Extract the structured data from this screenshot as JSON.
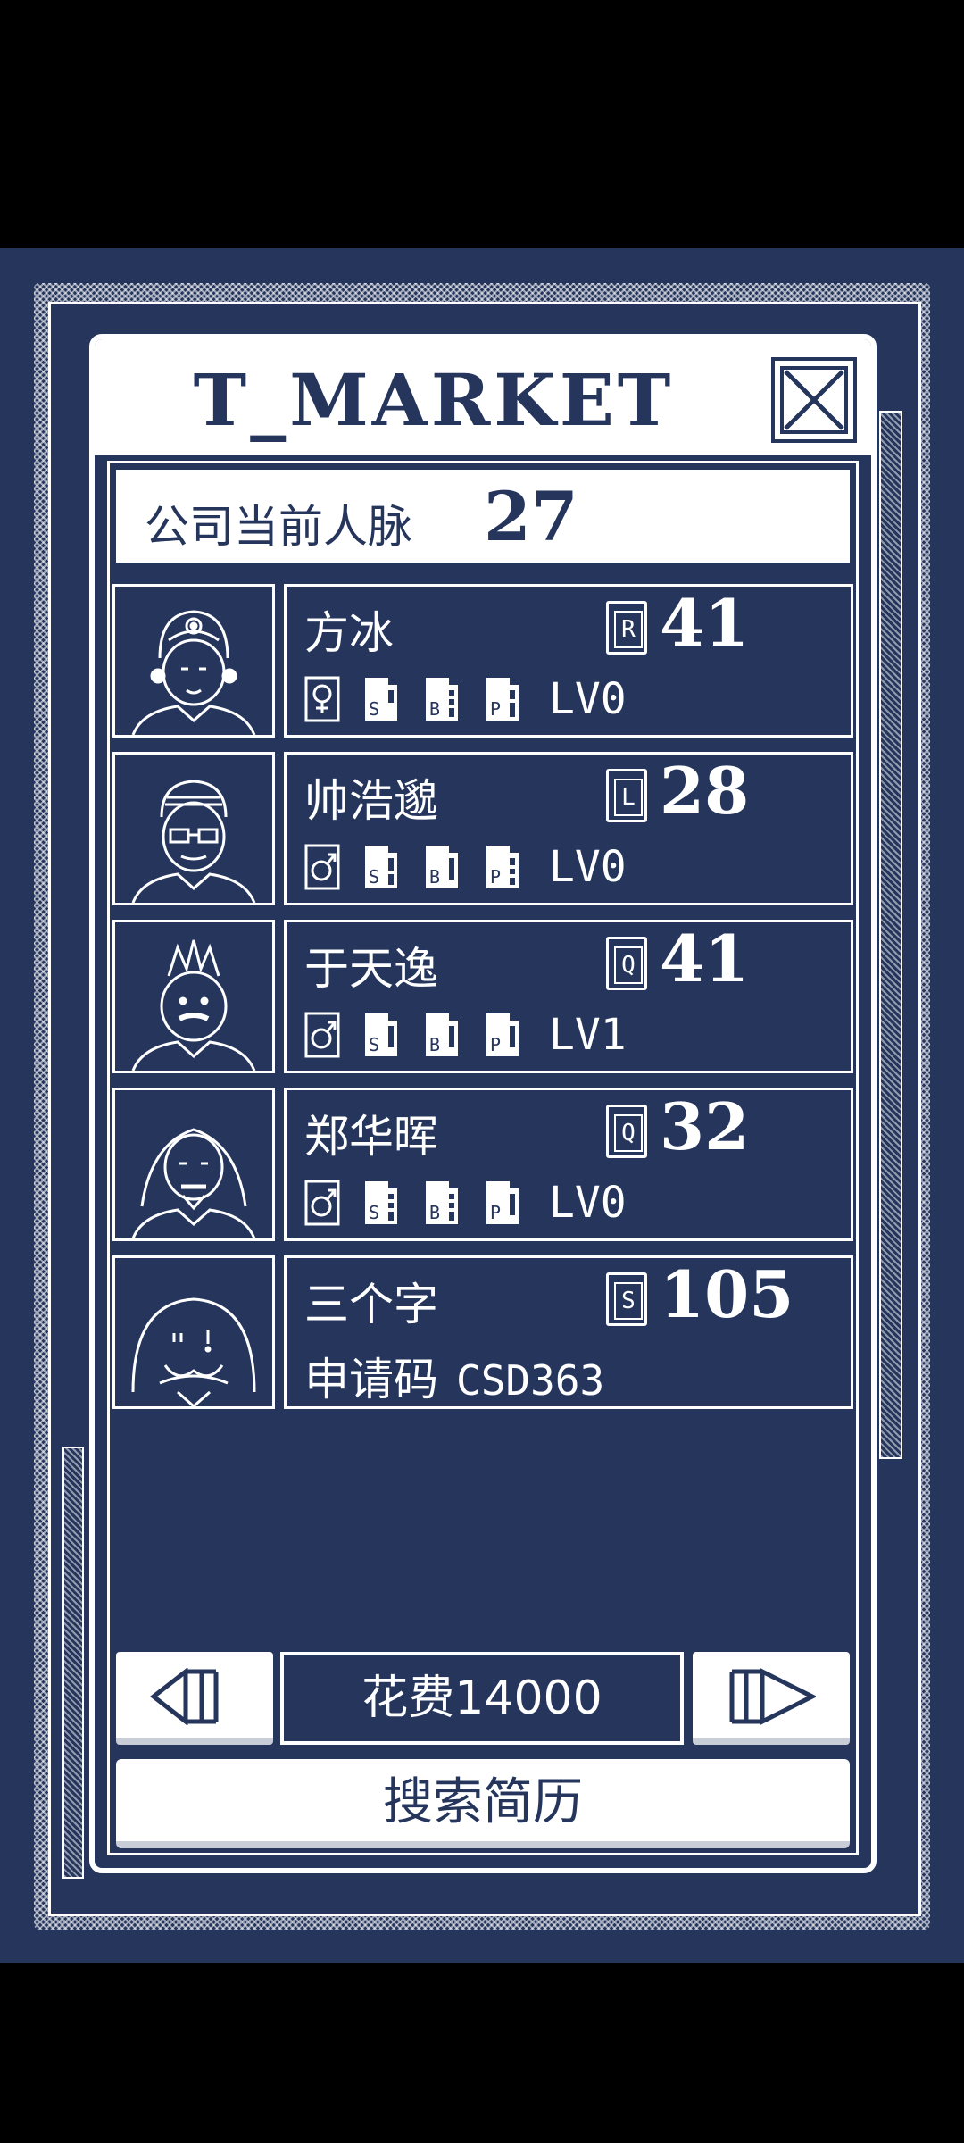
{
  "title": "T_MARKET",
  "network": {
    "label": "公司当前人脉",
    "value": "27"
  },
  "candidates": [
    {
      "name": "方冰",
      "rank": "R",
      "score": "41",
      "gender": "female",
      "stats": [
        "S",
        "B",
        "P"
      ],
      "level": "LV0"
    },
    {
      "name": "帅浩邈",
      "rank": "L",
      "score": "28",
      "gender": "male",
      "stats": [
        "S",
        "B",
        "P"
      ],
      "level": "LV0"
    },
    {
      "name": "于天逸",
      "rank": "Q",
      "score": "41",
      "gender": "male",
      "stats": [
        "S",
        "B",
        "P"
      ],
      "level": "LV1"
    },
    {
      "name": "郑华晖",
      "rank": "Q",
      "score": "32",
      "gender": "male",
      "stats": [
        "S",
        "B",
        "P"
      ],
      "level": "LV0"
    },
    {
      "name": "三个字",
      "rank": "S",
      "score": "105",
      "code_label": "申请码",
      "code": "CSD363"
    }
  ],
  "cost_label": "花费14000",
  "search_label": "搜索简历",
  "icons": {
    "close": "close-x-icon",
    "prev": "prev-page-icon",
    "next": "next-page-icon"
  },
  "colors": {
    "background": "#25355c",
    "foreground": "#ffffff"
  }
}
